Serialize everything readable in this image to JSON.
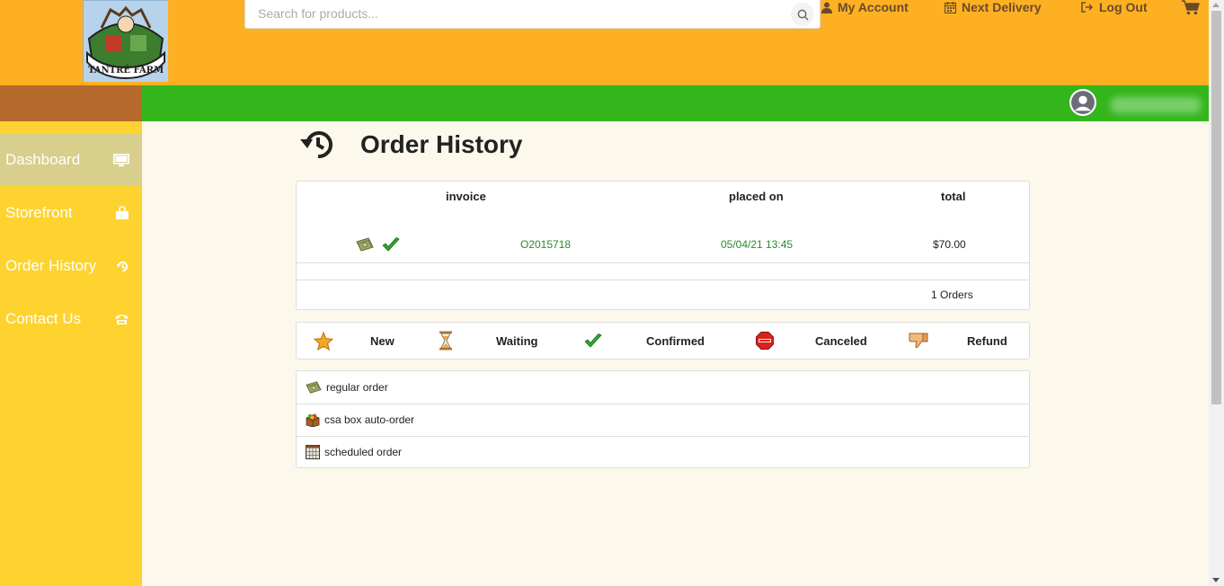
{
  "header": {
    "logo_text": "TANTRÉ FARM",
    "search_placeholder": "Search for products...",
    "nav": [
      {
        "label": "My Account",
        "icon": "user-icon"
      },
      {
        "label": "Next Delivery",
        "icon": "calendar-icon"
      },
      {
        "label": "Log Out",
        "icon": "logout-icon"
      }
    ],
    "cart_icon": "cart-icon"
  },
  "sidebar": {
    "items": [
      {
        "label": "Dashboard",
        "icon": "monitor-icon",
        "active": true
      },
      {
        "label": "Storefront",
        "icon": "shopping-bag-icon",
        "active": false
      },
      {
        "label": "Order History",
        "icon": "history-icon",
        "active": false
      },
      {
        "label": "Contact Us",
        "icon": "phone-icon",
        "active": false
      }
    ]
  },
  "page": {
    "title": "Order History",
    "title_icon": "history-icon"
  },
  "orders_table": {
    "columns": [
      "invoice",
      "placed on",
      "total"
    ],
    "rows": [
      {
        "type_icon": "regular-order-icon",
        "status_icon": "confirmed-check-icon",
        "invoice": "O2015718",
        "placed_on": "05/04/21 13:45",
        "total": "$70.00"
      }
    ],
    "footer_count": "1",
    "footer_label": "Orders"
  },
  "status_legend": [
    {
      "label": "New",
      "icon": "star-icon"
    },
    {
      "label": "Waiting",
      "icon": "hourglass-icon"
    },
    {
      "label": "Confirmed",
      "icon": "check-icon"
    },
    {
      "label": "Canceled",
      "icon": "stop-sign-icon"
    },
    {
      "label": "Refund",
      "icon": "thumbs-down-icon"
    }
  ],
  "order_types": [
    {
      "label": "regular order",
      "icon": "regular-order-icon"
    },
    {
      "label": "csa box auto-order",
      "icon": "csa-box-icon"
    },
    {
      "label": "scheduled order",
      "icon": "calendar-grid-icon"
    }
  ],
  "colors": {
    "header": "#fdb022",
    "sidebar": "#fed330",
    "sidebar_active": "#d7cf8b",
    "green_bar": "#33b51b",
    "brown_bar": "#b5692a",
    "link_green": "#2a8a2a"
  }
}
